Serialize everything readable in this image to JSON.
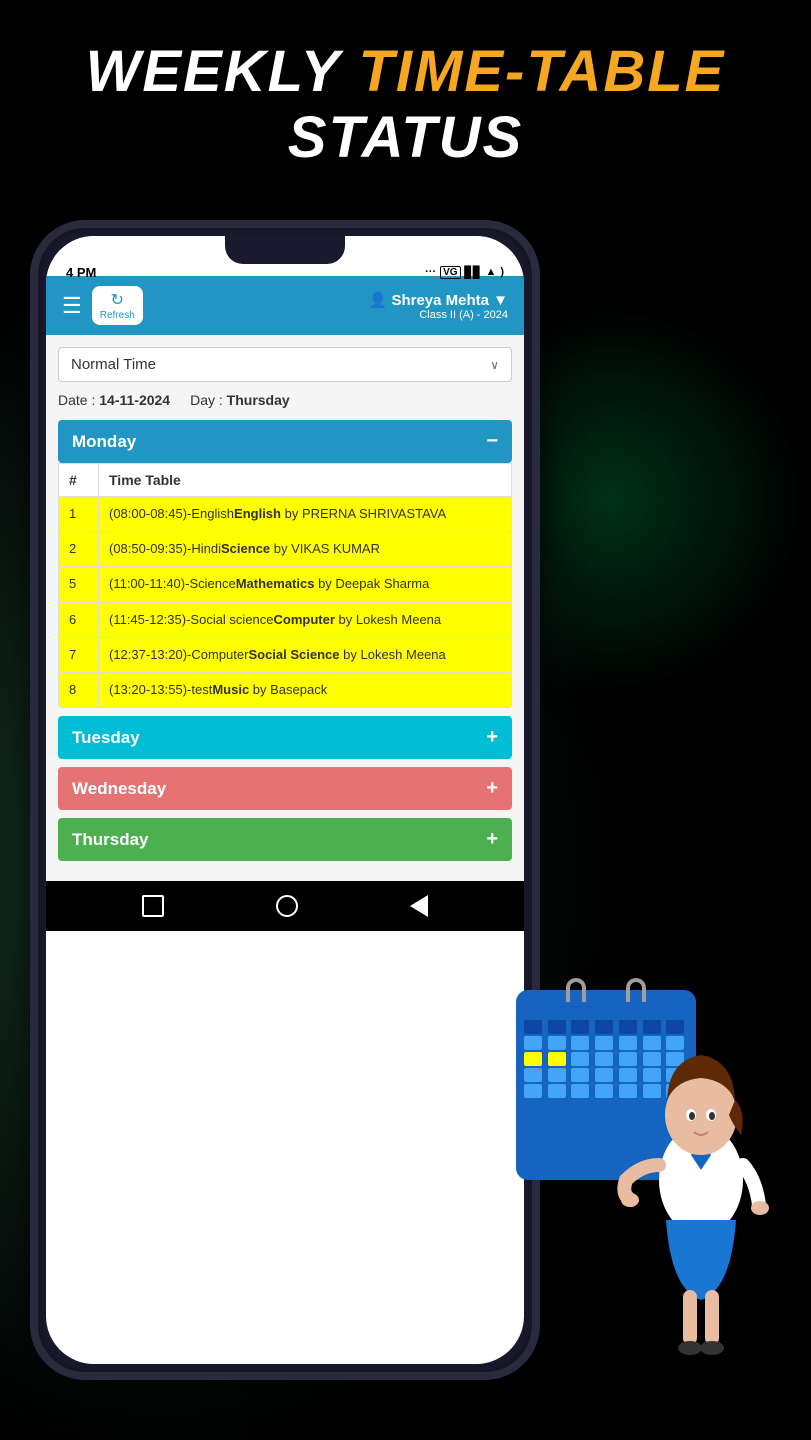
{
  "title": {
    "line1_part1": "WEEKLY ",
    "line1_part2": "TIME-TABLE",
    "line2": "STATUS"
  },
  "phone": {
    "status_bar": {
      "time": "4 PM",
      "icons": "... ▣ ull ▲ )"
    },
    "header": {
      "hamburger": "☰",
      "refresh_label": "Refresh",
      "user_icon": "👤",
      "user_name": "Shreya Mehta",
      "user_name_arrow": "▼",
      "user_class": "Class II (A) - 2024"
    },
    "dropdown": {
      "label": "Normal Time",
      "arrow": "∨"
    },
    "date_row": {
      "date_label": "Date :",
      "date_value": "14-11-2024",
      "day_label": "Day :",
      "day_value": "Thursday"
    },
    "days": [
      {
        "name": "Monday",
        "color_class": "monday",
        "expanded": true,
        "toggle": "−",
        "rows": [
          {
            "num": "1",
            "entry_prefix": "(08:00-08:45)-English",
            "entry_bold": "English",
            "entry_suffix": " by PRERNA SHRIVASTAVA"
          },
          {
            "num": "2",
            "entry_prefix": "(08:50-09:35)-Hindi",
            "entry_bold": "Science",
            "entry_suffix": " by VIKAS KUMAR"
          },
          {
            "num": "5",
            "entry_prefix": "(11:00-11:40)-Science",
            "entry_bold": "Mathematics",
            "entry_suffix": " by Deepak Sharma"
          },
          {
            "num": "6",
            "entry_prefix": "(11:45-12:35)-Social science",
            "entry_bold": "Computer",
            "entry_suffix": " by Lokesh Meena"
          },
          {
            "num": "7",
            "entry_prefix": "(12:37-13:20)-Computer",
            "entry_bold": "Social Science",
            "entry_suffix": " by Lokesh Meena"
          },
          {
            "num": "8",
            "entry_prefix": "(13:20-13:55)-test",
            "entry_bold": "Music",
            "entry_suffix": " by Basepack"
          }
        ]
      },
      {
        "name": "Tuesday",
        "color_class": "tuesday",
        "expanded": false,
        "toggle": "+"
      },
      {
        "name": "Wednesday",
        "color_class": "wednesday",
        "expanded": false,
        "toggle": "+"
      },
      {
        "name": "Thursday",
        "color_class": "thursday",
        "expanded": false,
        "toggle": "+"
      }
    ],
    "table_headers": {
      "num": "#",
      "timetable": "Time Table"
    },
    "bottom_nav": {
      "square": "□",
      "circle": "○",
      "triangle": "◁"
    }
  }
}
